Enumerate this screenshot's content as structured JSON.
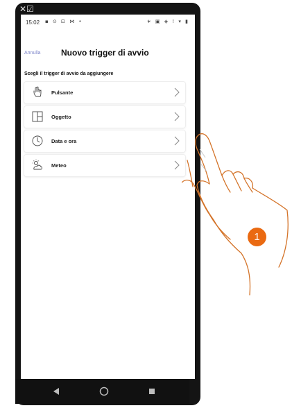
{
  "status_bar": {
    "time": "15:02",
    "left_icons": "▪ ⊙ ⊡ ⋈ •",
    "right_icons": "∗ ▣ ◈ ! ▾ ▮"
  },
  "device_corner_glyphs": "✕☑",
  "header": {
    "cancel_label": "Annulla",
    "title": "Nuovo trigger di avvio"
  },
  "section_title": "Scegli il trigger di avvio da aggiungere",
  "triggers": [
    {
      "label": "Pulsante",
      "icon": "hand-tap-icon"
    },
    {
      "label": "Oggetto",
      "icon": "object-icon"
    },
    {
      "label": "Data e ora",
      "icon": "clock-icon"
    },
    {
      "label": "Meteo",
      "icon": "weather-icon"
    }
  ],
  "nav_bar": {
    "back": "back-icon",
    "home": "home-icon",
    "recent": "recent-apps-icon"
  },
  "step_badge": "1",
  "colors": {
    "accent_link": "#7b83c9",
    "step_badge": "#ea6a12",
    "phone_frame": "#141414"
  }
}
